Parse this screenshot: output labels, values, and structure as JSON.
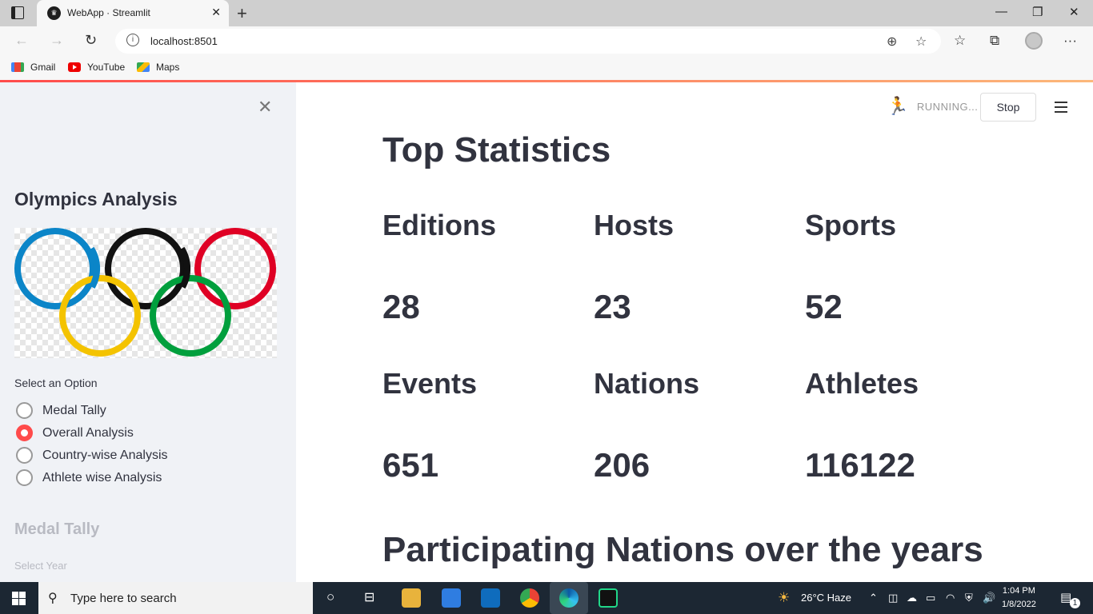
{
  "browser": {
    "tab_title": "WebApp · Streamlit",
    "url": "localhost:8501",
    "bookmarks": [
      {
        "label": "Gmail",
        "icon": "gmail-icon"
      },
      {
        "label": "YouTube",
        "icon": "youtube-icon"
      },
      {
        "label": "Maps",
        "icon": "maps-icon"
      }
    ]
  },
  "sidebar": {
    "title": "Olympics Analysis",
    "image": "olympic-rings-logo",
    "select_label": "Select an Option",
    "options": [
      {
        "label": "Medal Tally",
        "selected": false
      },
      {
        "label": "Overall Analysis",
        "selected": true
      },
      {
        "label": "Country-wise Analysis",
        "selected": false
      },
      {
        "label": "Athlete wise Analysis",
        "selected": false
      }
    ],
    "stale_heading": "Medal Tally",
    "stale_label": "Select Year"
  },
  "app": {
    "status": "RUNNING...",
    "stop_label": "Stop",
    "page_title": "Top Statistics",
    "stats": [
      {
        "label": "Editions",
        "value": "28"
      },
      {
        "label": "Hosts",
        "value": "23"
      },
      {
        "label": "Sports",
        "value": "52"
      },
      {
        "label": "Events",
        "value": "651"
      },
      {
        "label": "Nations",
        "value": "206"
      },
      {
        "label": "Athletes",
        "value": "116122"
      }
    ],
    "section_title": "Participating Nations over the years"
  },
  "taskbar": {
    "search_placeholder": "Type here to search",
    "weather": "26°C  Haze",
    "time": "1:04 PM",
    "date": "1/8/2022",
    "notification_count": "1"
  },
  "colors": {
    "accent": "#ff4b4b",
    "sidebar_bg": "#f0f2f6",
    "text": "#31333f"
  }
}
